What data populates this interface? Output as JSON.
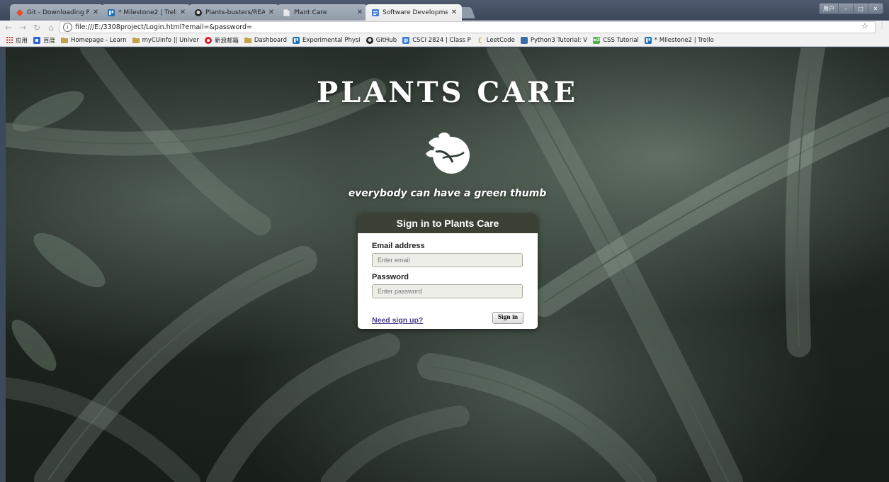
{
  "browser": {
    "tabs": [
      {
        "label": "Git - Downloading Pac",
        "icon": "git-icon",
        "color": "#e24e2d"
      },
      {
        "label": "* Milestone2 | Trello",
        "icon": "trello-icon",
        "color": "#1d6fb8"
      },
      {
        "label": "Plants-busters/READM",
        "icon": "github-icon",
        "color": "#222222"
      },
      {
        "label": "Plant Care",
        "icon": "page-icon",
        "color": "#bbbbbb"
      },
      {
        "label": "Software Development",
        "icon": "docs-icon",
        "color": "#4a7fd8"
      }
    ],
    "active_tab_index": 4,
    "window_controls": {
      "extra": "用户",
      "minimize": "–",
      "maximize": "□",
      "close": "✕"
    },
    "url": "file:///E:/3308project/Login.html?email=&password=",
    "bookmarks": [
      {
        "label": "应用",
        "icon": "apps-grid-icon",
        "color": "#d0362a"
      },
      {
        "label": "百度",
        "icon": "baidu-icon",
        "color": "#2a62d6"
      },
      {
        "label": "Homepage - Learn",
        "icon": "folder-icon",
        "color": "#c2a14a"
      },
      {
        "label": "myCUinfo || Univer",
        "icon": "folder-icon",
        "color": "#c2a14a"
      },
      {
        "label": "新浪邮箱",
        "icon": "sina-icon",
        "color": "#d6202a"
      },
      {
        "label": "Dashboard",
        "icon": "folder-icon",
        "color": "#c2a14a"
      },
      {
        "label": "Experimental Physi",
        "icon": "trello-icon",
        "color": "#1d6fb8"
      },
      {
        "label": "GitHub",
        "icon": "github-icon",
        "color": "#222222"
      },
      {
        "label": "CSCI 2824 | Class P",
        "icon": "piazza-icon",
        "color": "#3a7bd5"
      },
      {
        "label": "LeetCode",
        "icon": "leetcode-icon",
        "color": "#e8a23a"
      },
      {
        "label": "Python3 Tutorial: V",
        "icon": "python-icon",
        "color": "#3a6ea5"
      },
      {
        "label": "CSS Tutorial",
        "icon": "w3-icon",
        "color": "#4caf50"
      },
      {
        "label": "* Milestone2 | Trello",
        "icon": "trello-icon",
        "color": "#1d6fb8"
      }
    ]
  },
  "page": {
    "brand_title": "PLANTS CARE",
    "tagline": "everybody can have a green thumb",
    "login": {
      "heading": "Sign in to Plants Care",
      "email_label": "Email address",
      "email_placeholder": "Enter email",
      "password_label": "Password",
      "password_placeholder": "Enter password",
      "signup_link": "Need sign up?",
      "signin_button": "Sign in"
    },
    "colors": {
      "card_header": "#3a4134",
      "link": "#4a3f8c"
    }
  }
}
